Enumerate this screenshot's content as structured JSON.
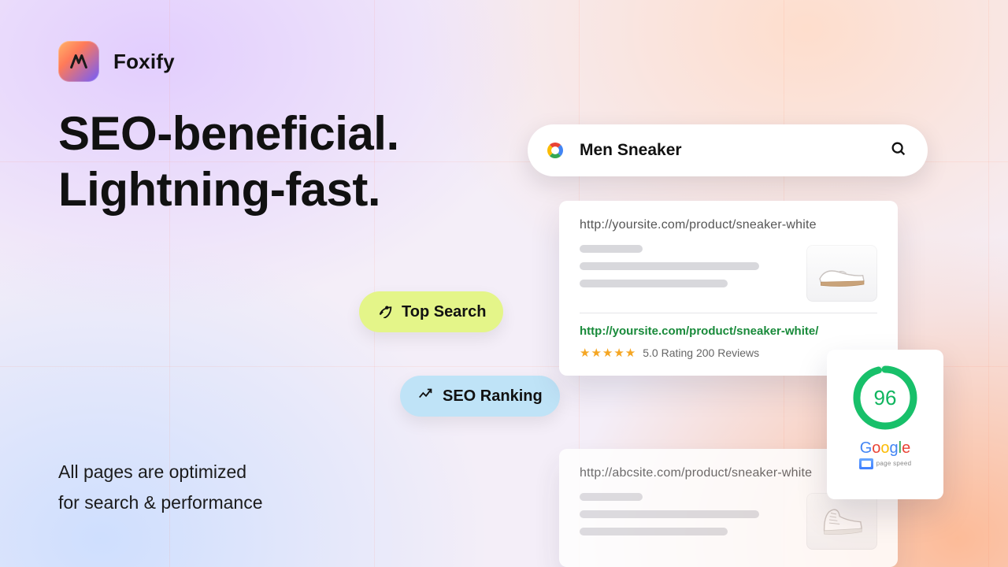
{
  "brand": {
    "name": "Foxify"
  },
  "headline": {
    "line1": "SEO-beneficial.",
    "line2": "Lightning-fast."
  },
  "subtext": {
    "line1": "All pages are optimized",
    "line2": "for search & performance"
  },
  "pills": {
    "top_search": "Top Search",
    "seo_ranking": "SEO Ranking"
  },
  "search": {
    "query": "Men Sneaker"
  },
  "result1": {
    "url": "http://yoursite.com/product/sneaker-white",
    "green_url": "http://yoursite.com/product/sneaker-white/",
    "rating_value": "5.0",
    "rating_label": "Rating",
    "review_count": "200",
    "review_label": "Reviews"
  },
  "result2": {
    "url": "http://abcsite.com/product/sneaker-white"
  },
  "pagespeed": {
    "score": "96",
    "brand": "Google",
    "sub": "page speed"
  }
}
